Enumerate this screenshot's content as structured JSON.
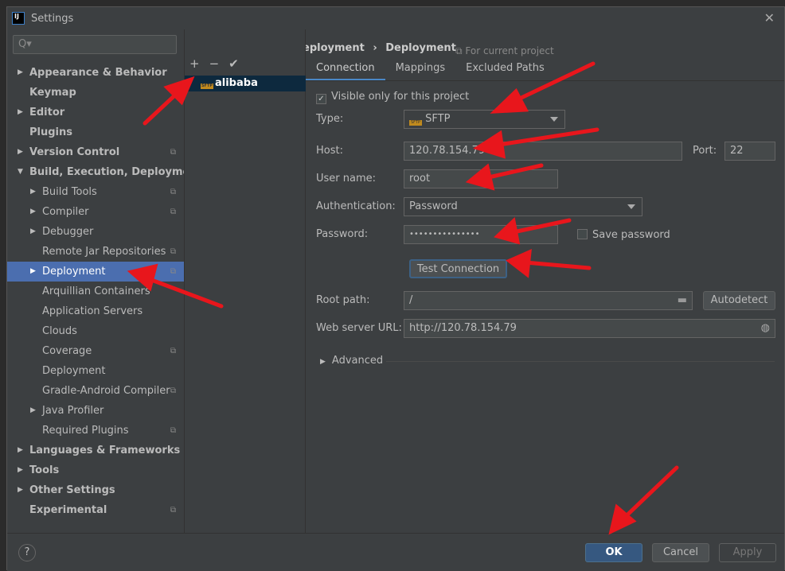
{
  "window": {
    "title": "Settings",
    "logo": "IJ"
  },
  "search": {
    "placeholder": "Q▾"
  },
  "sidebar": {
    "items": [
      {
        "label": "Appearance & Behavior",
        "arrow": "▶",
        "bold": true,
        "level": 0
      },
      {
        "label": "Keymap",
        "bold": true,
        "level": 0
      },
      {
        "label": "Editor",
        "arrow": "▶",
        "bold": true,
        "level": 0
      },
      {
        "label": "Plugins",
        "bold": true,
        "level": 0
      },
      {
        "label": "Version Control",
        "arrow": "▶",
        "bold": true,
        "level": 0,
        "copy": true
      },
      {
        "label": "Build, Execution, Deployment",
        "arrow": "▼",
        "bold": true,
        "level": 0
      },
      {
        "label": "Build Tools",
        "arrow": "▶",
        "level": 1,
        "copy": true
      },
      {
        "label": "Compiler",
        "arrow": "▶",
        "level": 1,
        "copy": true
      },
      {
        "label": "Debugger",
        "arrow": "▶",
        "level": 1
      },
      {
        "label": "Remote Jar Repositories",
        "level": 1,
        "copy": true
      },
      {
        "label": "Deployment",
        "arrow": "▶",
        "level": 1,
        "copy": true,
        "selected": true
      },
      {
        "label": "Arquillian Containers",
        "level": 1
      },
      {
        "label": "Application Servers",
        "level": 1
      },
      {
        "label": "Clouds",
        "level": 1
      },
      {
        "label": "Coverage",
        "level": 1,
        "copy": true
      },
      {
        "label": "Deployment",
        "level": 1
      },
      {
        "label": "Gradle-Android Compiler",
        "level": 1,
        "copy": true
      },
      {
        "label": "Java Profiler",
        "arrow": "▶",
        "level": 1
      },
      {
        "label": "Required Plugins",
        "level": 1,
        "copy": true
      },
      {
        "label": "Languages & Frameworks",
        "arrow": "▶",
        "bold": true,
        "level": 0
      },
      {
        "label": "Tools",
        "arrow": "▶",
        "bold": true,
        "level": 0
      },
      {
        "label": "Other Settings",
        "arrow": "▶",
        "bold": true,
        "level": 0
      },
      {
        "label": "Experimental",
        "bold": true,
        "level": 0,
        "copy": true
      }
    ]
  },
  "breadcrumb": {
    "parent": "Build, Execution, Deployment",
    "sep": "›",
    "current": "Deployment",
    "scope": "For current project"
  },
  "servers": {
    "toolbar": [
      "+",
      "−",
      "✔"
    ],
    "items": [
      {
        "name": "alibaba",
        "type_badge": "SFTP"
      }
    ]
  },
  "tabs": [
    "Connection",
    "Mappings",
    "Excluded Paths"
  ],
  "form": {
    "visible_only": {
      "label": "Visible only for this project",
      "checked": true
    },
    "type": {
      "label": "Type:",
      "value": "SFTP"
    },
    "host": {
      "label": "Host:",
      "value": "120.78.154.79"
    },
    "port": {
      "label": "Port:",
      "value": "22"
    },
    "username": {
      "label": "User name:",
      "value": "root"
    },
    "auth": {
      "label": "Authentication:",
      "value": "Password"
    },
    "password": {
      "label": "Password:",
      "value": "•••••••••••••••"
    },
    "save_password": {
      "label": "Save password",
      "checked": false
    },
    "test_connection": "Test Connection",
    "root_path": {
      "label": "Root path:",
      "value": "/"
    },
    "autodetect": "Autodetect",
    "web_url": {
      "label": "Web server URL:",
      "value": "http://120.78.154.79"
    },
    "advanced": "Advanced"
  },
  "footer": {
    "help": "?",
    "ok": "OK",
    "cancel": "Cancel",
    "apply": "Apply"
  }
}
